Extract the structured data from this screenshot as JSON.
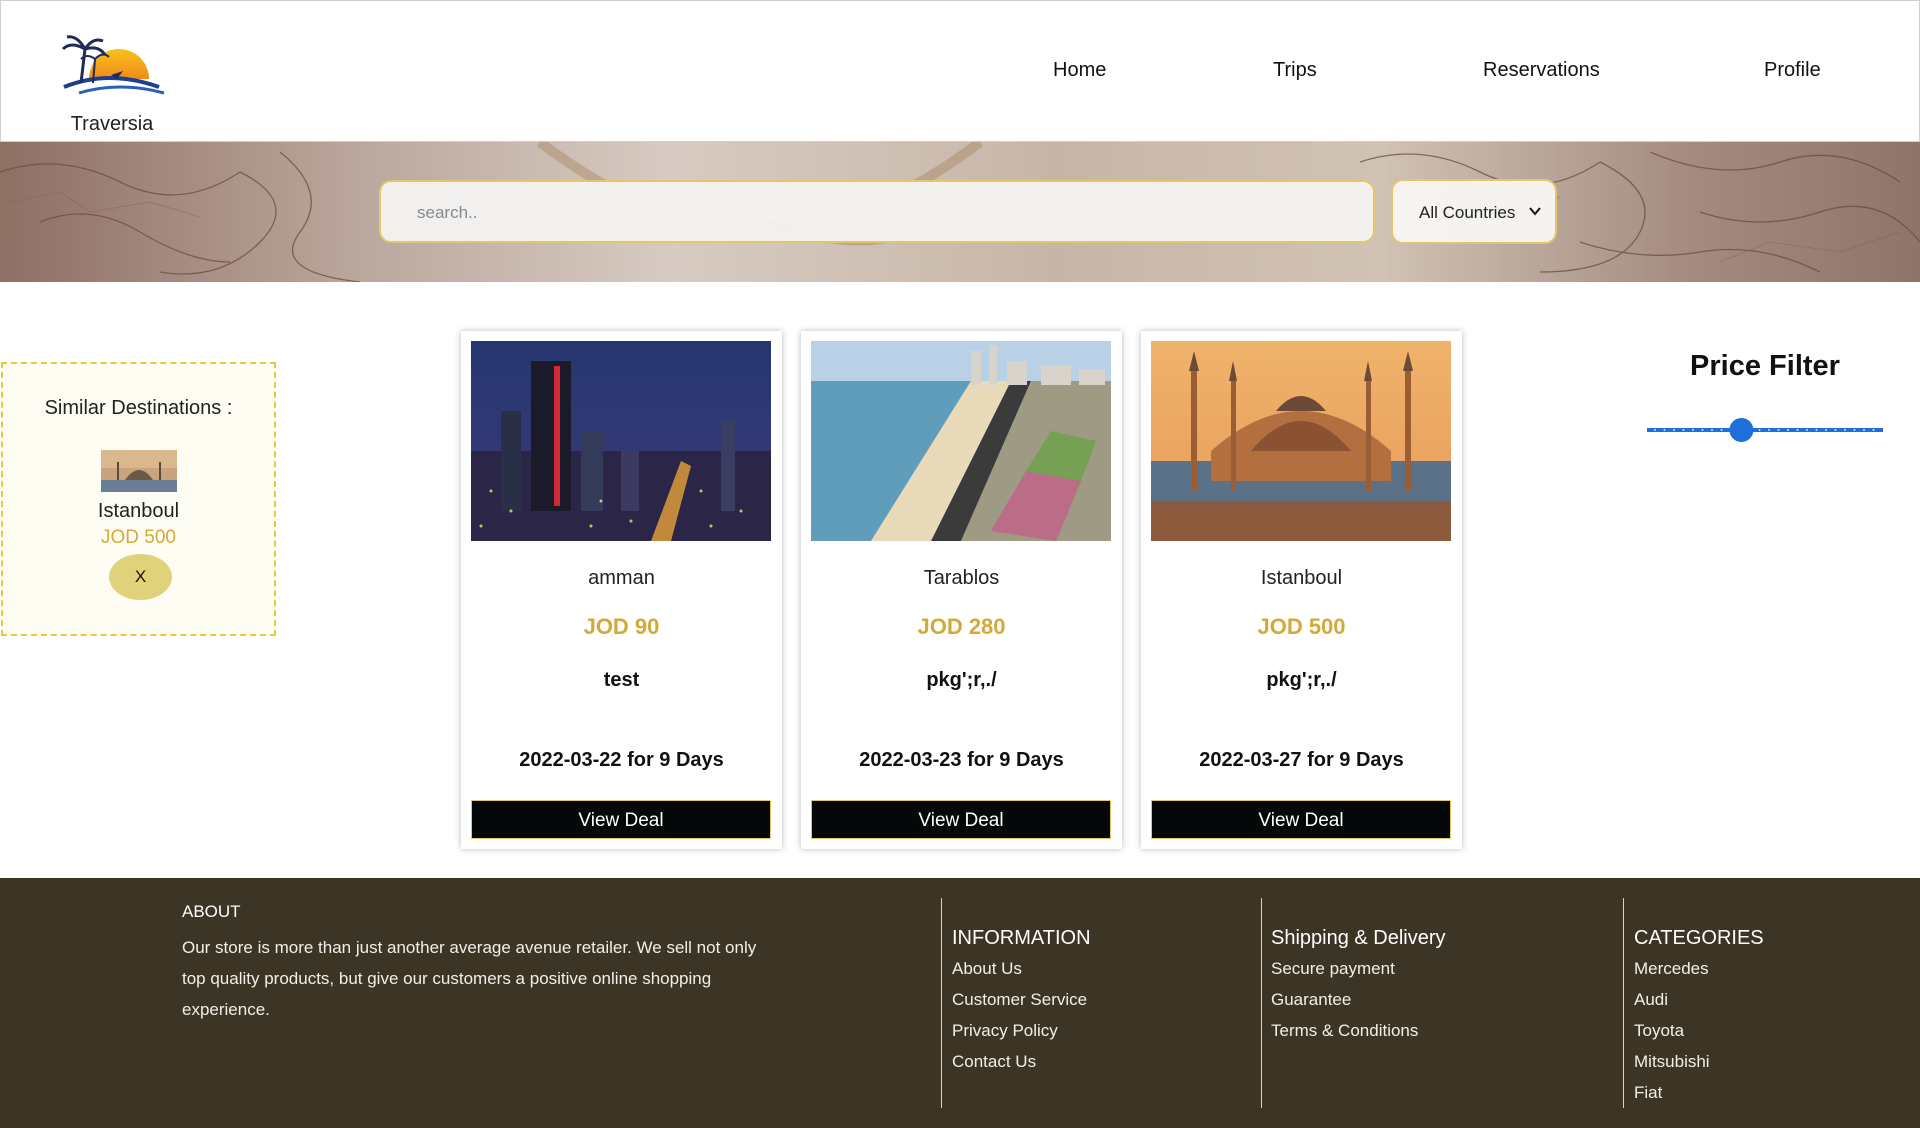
{
  "header": {
    "brand": "Traversia",
    "nav": [
      "Home",
      "Trips",
      "Reservations",
      "Profile"
    ]
  },
  "search": {
    "placeholder": "search..",
    "country_select": "All Countries"
  },
  "similar": {
    "title": "Similar Destinations :",
    "name": "Istanboul",
    "price": "JOD 500",
    "remove_label": "X"
  },
  "cards": [
    {
      "name": "amman",
      "price": "JOD 90",
      "description": "test",
      "date": "2022-03-22 for 9 Days",
      "button": "View Deal"
    },
    {
      "name": "Tarablos",
      "price": "JOD 280",
      "description": "pkg';r,./",
      "date": "2022-03-23 for 9 Days",
      "button": "View Deal"
    },
    {
      "name": "Istanboul",
      "price": "JOD 500",
      "description": "pkg';r,./",
      "date": "2022-03-27 for 9 Days",
      "button": "View Deal"
    }
  ],
  "price_filter": {
    "title": "Price Filter",
    "value_fraction": 0.4
  },
  "footer": {
    "about_heading": "ABOUT",
    "about_text": "Our store is more than just another average avenue retailer. We sell not only top quality products, but give our customers a positive online shopping experience.",
    "information": {
      "heading": "INFORMATION",
      "links": [
        "About Us",
        "Customer Service",
        "Privacy Policy",
        "Contact Us"
      ]
    },
    "shipping": {
      "heading": "Shipping & Delivery",
      "links": [
        "Secure payment",
        "Guarantee",
        "Terms & Conditions"
      ]
    },
    "categories": {
      "heading": "CATEGORIES",
      "links": [
        "Mercedes",
        "Audi",
        "Toyota",
        "Mitsubishi",
        "Fiat"
      ]
    }
  },
  "colors": {
    "accent_gold": "#d4a93a",
    "footer_bg": "#3c3526",
    "slider_blue": "#1e6fd9",
    "button_bg": "#050808"
  }
}
